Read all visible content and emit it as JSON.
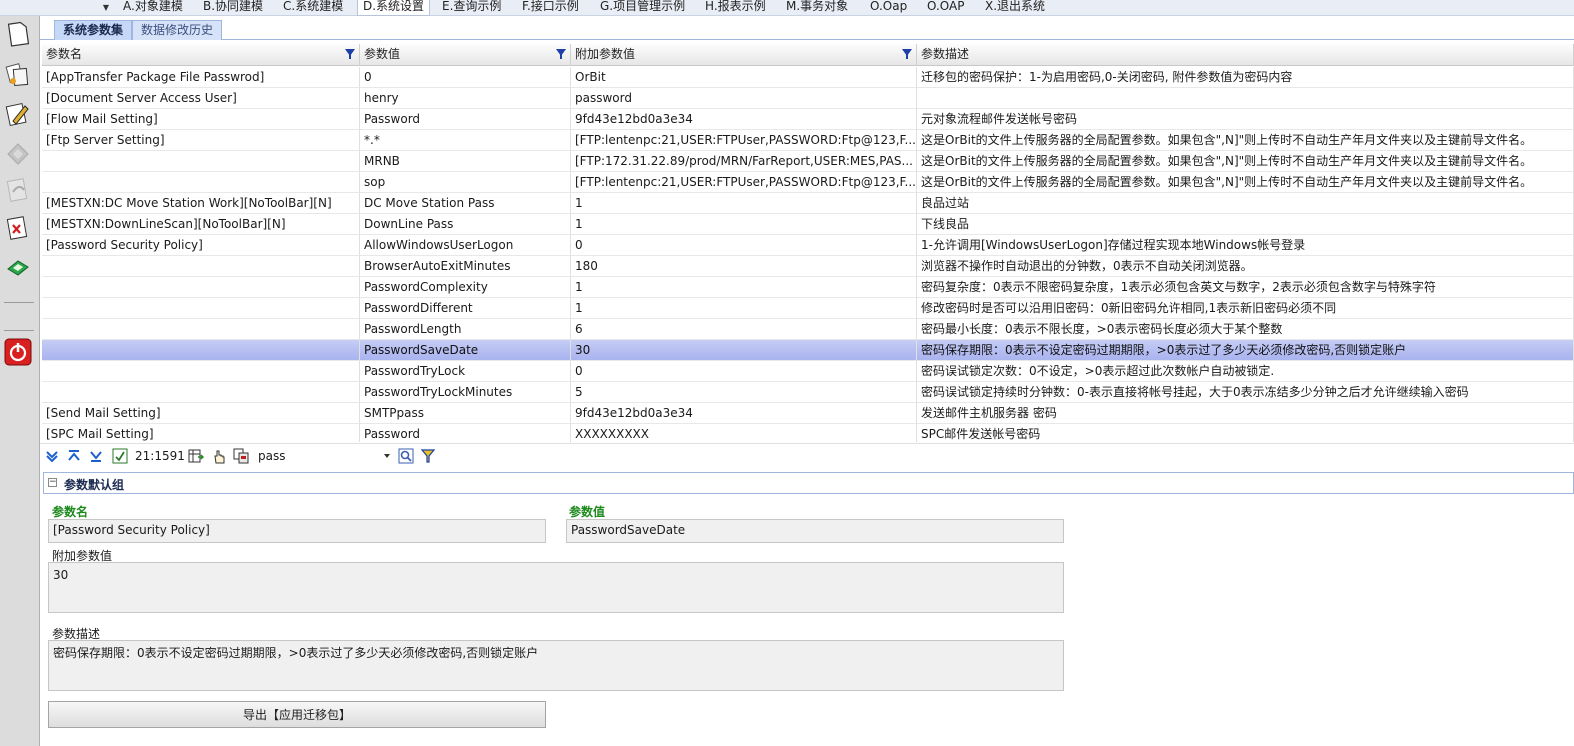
{
  "menu": {
    "items": [
      "A.对象建模",
      "B.协同建模",
      "C.系统建模",
      "D.系统设置",
      "E.查询示例",
      "F.接口示例",
      "G.项目管理示例",
      "H.报表示例",
      "M.事务对象",
      "O.Oap",
      "O.OAP",
      "X.退出系统"
    ],
    "active_index": 3
  },
  "tabs": [
    "系统参数集",
    "数据修改历史"
  ],
  "grid": {
    "columns": [
      "参数名",
      "参数值",
      "附加参数值",
      "参数描述"
    ],
    "rows": [
      {
        "name": "[AppTransfer Package File Passwrod]",
        "value": "0",
        "extra": "OrBit",
        "desc": "迁移包的密码保护：1-为启用密码,0-关闭密码, 附件参数值为密码内容"
      },
      {
        "name": "[Document Server Access User]",
        "value": "henry",
        "extra": "password",
        "desc": ""
      },
      {
        "name": "[Flow Mail Setting]",
        "value": "Password",
        "extra": "9fd43e12bd0a3e34",
        "desc": "元对象流程邮件发送帐号密码"
      },
      {
        "name": "[Ftp Server Setting]",
        "value": "*.*",
        "extra": "[FTP:lentenpc:21,USER:FTPUser,PASSWORD:Ftp@123,F...",
        "desc": "这是OrBit的文件上传服务器的全局配置参数。如果包含\",N]\"则上传时不自动生产年月文件夹以及主键前导文件名。"
      },
      {
        "name": "",
        "value": "MRNB",
        "extra": "[FTP:172.31.22.89/prod/MRN/FarReport,USER:MES,PAS...",
        "desc": "这是OrBit的文件上传服务器的全局配置参数。如果包含\",N]\"则上传时不自动生产年月文件夹以及主键前导文件名。"
      },
      {
        "name": "",
        "value": "sop",
        "extra": "[FTP:lentenpc:21,USER:FTPUser,PASSWORD:Ftp@123,F...",
        "desc": "这是OrBit的文件上传服务器的全局配置参数。如果包含\",N]\"则上传时不自动生产年月文件夹以及主键前导文件名。"
      },
      {
        "name": "[MESTXN:DC Move Station Work][NoToolBar][N]",
        "value": "DC Move Station Pass",
        "extra": "1",
        "desc": "良品过站"
      },
      {
        "name": "[MESTXN:DownLineScan][NoToolBar][N]",
        "value": "DownLine Pass",
        "extra": "1",
        "desc": "下线良品"
      },
      {
        "name": "[Password Security Policy]",
        "value": "AllowWindowsUserLogon",
        "extra": "0",
        "desc": "1-允许调用[WindowsUserLogon]存储过程实现本地Windows帐号登录"
      },
      {
        "name": "",
        "value": "BrowserAutoExitMinutes",
        "extra": "180",
        "desc": "浏览器不操作时自动退出的分钟数，0表示不自动关闭浏览器。"
      },
      {
        "name": "",
        "value": "PasswordComplexity",
        "extra": "1",
        "desc": "密码复杂度：0表示不限密码复杂度，1表示必须包含英文与数字，2表示必须包含数字与特殊字符"
      },
      {
        "name": "",
        "value": "PasswordDifferent",
        "extra": "1",
        "desc": "修改密码时是否可以沿用旧密码：0新旧密码允许相同,1表示新旧密码必须不同"
      },
      {
        "name": "",
        "value": "PasswordLength",
        "extra": "6",
        "desc": "密码最小长度：0表示不限长度，>0表示密码长度必须大于某个整数"
      },
      {
        "name": "",
        "value": "PasswordSaveDate",
        "extra": "30",
        "desc": "密码保存期限：0表示不设定密码过期期限，>0表示过了多少天必须修改密码,否则锁定账户"
      },
      {
        "name": "",
        "value": "PasswordTryLock",
        "extra": "0",
        "desc": "密码误试锁定次数：0不设定，>0表示超过此次数帐户自动被锁定."
      },
      {
        "name": "",
        "value": "PasswordTryLockMinutes",
        "extra": "5",
        "desc": "密码误试锁定持续时分钟数：0-表示直接将帐号挂起，大于0表示冻结多少分钟之后才允许继续输入密码"
      },
      {
        "name": "[Send Mail Setting]",
        "value": "SMTPpass",
        "extra": "9fd43e12bd0a3e34",
        "desc": "发送邮件主机服务器 密码"
      },
      {
        "name": "[SPC Mail Setting]",
        "value": "Password",
        "extra": "XXXXXXXXX",
        "desc": "SPC邮件发送帐号密码"
      }
    ],
    "selected_index": 13
  },
  "navbar": {
    "position": "21:1591",
    "search_value": "pass"
  },
  "group": {
    "title": "参数默认组"
  },
  "form": {
    "name_label": "参数名",
    "name_value": "[Password Security Policy]",
    "value_label": "参数值",
    "value_value": "PasswordSaveDate",
    "extra_label": "附加参数值",
    "extra_value": "30",
    "desc_label": "参数描述",
    "desc_value": "密码保存期限：0表示不设定密码过期期限，>0表示过了多少天必须修改密码,否则锁定账户"
  },
  "export_button": "导出【应用迁移包】",
  "colors": {
    "accent": "#9fb6de",
    "selected_row": "#b7bff0",
    "label_green": "#1e8a1e",
    "filter_icon": "#1c3fa8"
  },
  "toolbar_icons": [
    "new-document-icon",
    "copy-document-icon",
    "edit-pencil-icon",
    "disabled-diamond-icon",
    "undo-icon",
    "delete-document-icon",
    "save-green-icon",
    "power-exit-icon"
  ]
}
